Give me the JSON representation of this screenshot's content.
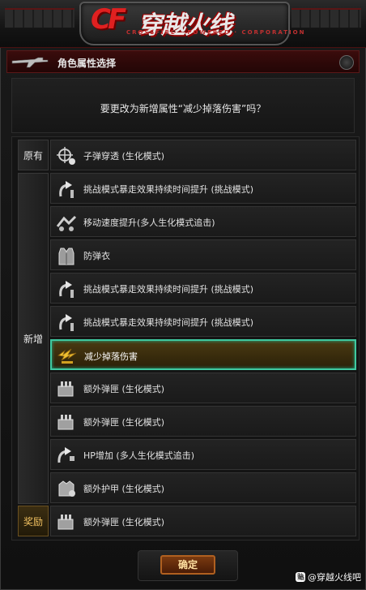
{
  "header": {
    "logo_text": "穿越火线",
    "logo_sub": "CROSSFIRE · POWERED · CORPORATION",
    "title": "角色属性选择"
  },
  "question": "要更改为新增属性“减少掉落伤害”吗？",
  "categories": {
    "original": "原有",
    "added": "新增",
    "reward": "奖励"
  },
  "rows": [
    {
      "icon": "crosshair-icon",
      "label": "子弹穿透 (生化模式)"
    },
    {
      "icon": "arrow-up-icon",
      "label": "挑战模式暴走效果持续时间提升 (挑战模式)"
    },
    {
      "icon": "speed-icon",
      "label": "移动速度提升(多人生化模式追击)"
    },
    {
      "icon": "vest-icon",
      "label": "防弹衣"
    },
    {
      "icon": "arrow-up-icon",
      "label": "挑战模式暴走效果持续时间提升 (挑战模式)"
    },
    {
      "icon": "arrow-up-icon",
      "label": "挑战模式暴走效果持续时间提升 (挑战模式)"
    },
    {
      "icon": "fall-damage-icon",
      "label": "减少掉落伤害",
      "selected": true
    },
    {
      "icon": "ammo-box-icon",
      "label": "额外弹匣 (生化模式)"
    },
    {
      "icon": "ammo-box-icon",
      "label": "额外弹匣 (生化模式)"
    },
    {
      "icon": "hp-icon",
      "label": "HP增加 (多人生化模式追击)"
    },
    {
      "icon": "armor-icon",
      "label": "额外护甲 (生化模式)"
    },
    {
      "icon": "ammo-box-icon",
      "label": "额外弹匣 (生化模式)"
    }
  ],
  "confirm_label": "确定",
  "watermark": "@穿越火线吧",
  "colors": {
    "selected_border": "#3fc9a0",
    "accent_red": "#e02020",
    "reward_gold": "#f0c060"
  }
}
